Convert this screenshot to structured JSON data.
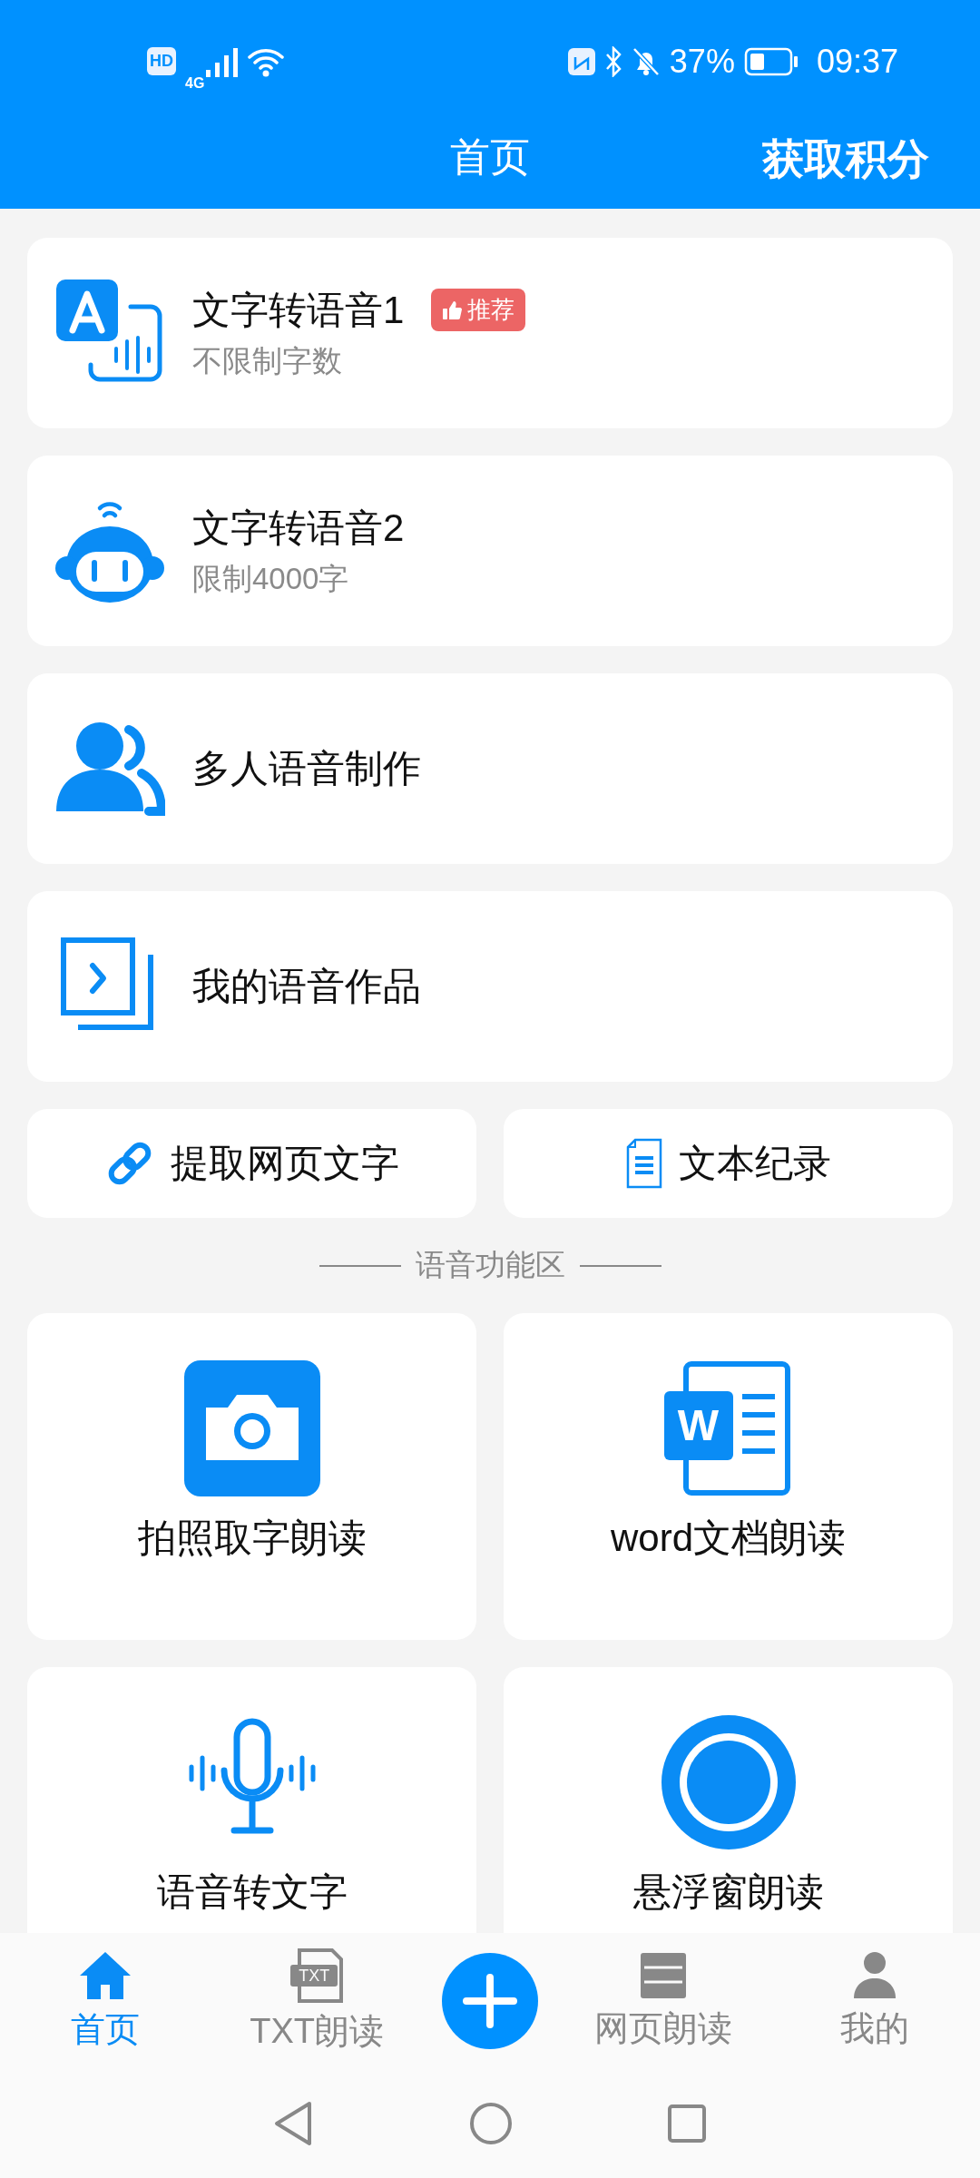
{
  "status_bar": {
    "hd": "HD",
    "network": "4G",
    "battery": "37%",
    "time": "09:37"
  },
  "header": {
    "title": "首页",
    "action": "获取积分"
  },
  "feature_cards": [
    {
      "title": "文字转语音1",
      "subtitle": "不限制字数",
      "badge": "推荐"
    },
    {
      "title": "文字转语音2",
      "subtitle": "限制4000字"
    },
    {
      "title": "多人语音制作"
    },
    {
      "title": "我的语音作品"
    }
  ],
  "quick_actions": [
    {
      "label": "提取网页文字"
    },
    {
      "label": "文本纪录"
    }
  ],
  "section_title": "语音功能区",
  "word_icon_text": "W",
  "function_tiles": [
    {
      "label": "拍照取字朗读"
    },
    {
      "label": "word文档朗读"
    },
    {
      "label": "语音转文字"
    },
    {
      "label": "悬浮窗朗读"
    }
  ],
  "bottom_nav": [
    {
      "kind": "tab",
      "label": "首页",
      "selected": true
    },
    {
      "kind": "tab",
      "icon_text": "TXT",
      "label": "TXT朗读",
      "selected": false
    },
    {
      "kind": "add"
    },
    {
      "kind": "tab",
      "label": "网页朗读",
      "selected": false
    },
    {
      "kind": "tab",
      "label": "我的",
      "selected": false
    }
  ]
}
